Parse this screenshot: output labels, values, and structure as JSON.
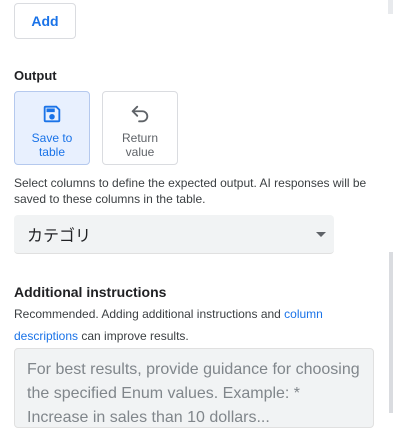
{
  "add_button": "Add",
  "output": {
    "title": "Output",
    "options": [
      {
        "label": "Save to\ntable",
        "icon": "save-icon",
        "selected": true
      },
      {
        "label": "Return\nvalue",
        "icon": "return-arrow-icon",
        "selected": false
      }
    ],
    "help": "Select columns to define the expected output. AI responses will be saved to these columns in the table.",
    "column_select": "カテゴリ"
  },
  "instructions": {
    "title": "Additional instructions",
    "desc_prefix": "Recommended. Adding additional instructions and ",
    "desc_link": "column descriptions",
    "desc_suffix": " can improve results.",
    "placeholder": "For best results, provide guidance for choosing the specified Enum values. Example: * Increase in sales than 10 dollars..."
  },
  "colors": {
    "accent": "#1a73e8",
    "selected_bg": "#e8f0fe"
  }
}
